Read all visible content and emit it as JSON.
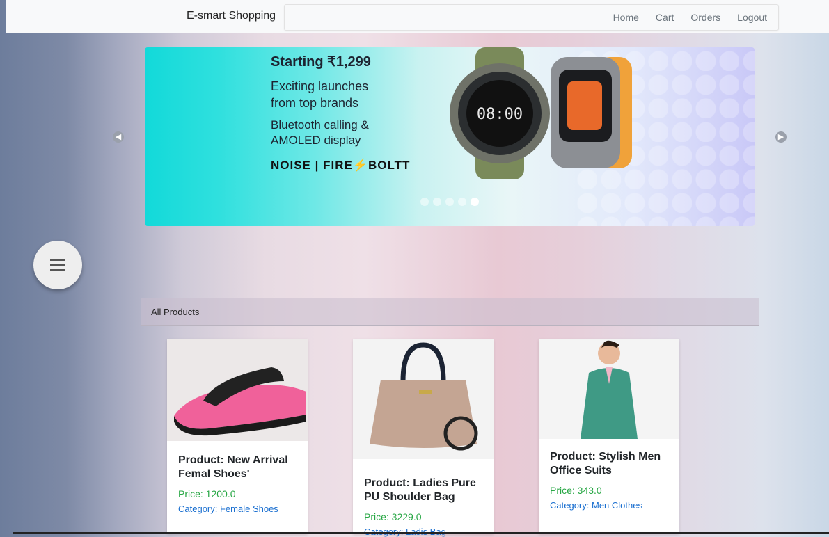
{
  "header": {
    "brand": "E-smart Shopping",
    "nav": [
      "Home",
      "Cart",
      "Orders",
      "Logout"
    ]
  },
  "banner": {
    "starting": "Starting ₹1,299",
    "line1": "Exciting launches",
    "line2": "from top brands",
    "line3": "Bluetooth calling &",
    "line4": "AMOLED display",
    "brands": "NOISE | FIRE⚡BOLTT",
    "watch_time": "08:00",
    "slide_count": 5,
    "active_slide": 5
  },
  "section": {
    "title": "All Products"
  },
  "products": [
    {
      "title": "Product: New Arrival Femal Shoes'",
      "price": "Price: 1200.0",
      "category_label": "Category: ",
      "category": "Female Shoes"
    },
    {
      "title": "Product: Ladies Pure PU Shoulder Bag",
      "price": "Price: 3229.0",
      "category_label": "Category: ",
      "category": "Ladis Bag"
    },
    {
      "title": "Product: Stylish Men Office Suits",
      "price": "Price: 343.0",
      "category_label": "Category: ",
      "category": "Men Clothes"
    }
  ],
  "colors": {
    "price": "#28a745",
    "category": "#1a6fd0",
    "accent": "#12d9d9"
  }
}
